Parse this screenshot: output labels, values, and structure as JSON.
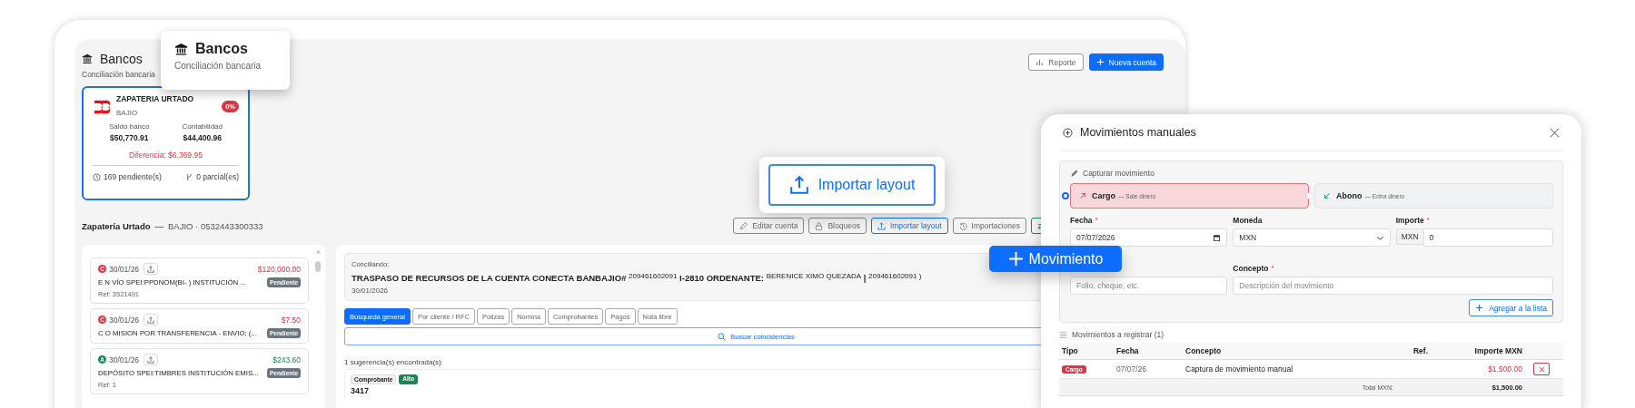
{
  "header": {
    "title": "Bancos",
    "subtitle": "Conciliación bancaria"
  },
  "header_actions": [
    {
      "label": "Reporte",
      "kind": "outline"
    },
    {
      "label": "Nueva cuenta",
      "kind": "primary"
    }
  ],
  "callout_bancos": {
    "title": "Bancos",
    "subtitle": "Conciliación bancaria"
  },
  "account_card": {
    "name": "ZAPATERIA URTADO",
    "bank": "BAJIO",
    "badge": "0%",
    "selected": true,
    "stats": [
      {
        "label": "Saldo banco",
        "value": "$50,770.91"
      },
      {
        "label": "Contabilidad",
        "value": "$44,400.96"
      }
    ],
    "difference": "Diferencia: $6,369.95",
    "pending": "169 pendiente(s)",
    "partial": "0 parcial(es)"
  },
  "account_bar": {
    "name": "Zapatería Urtado",
    "separator": "—",
    "detail": "BAJIO · 0532443300333"
  },
  "toolbar": [
    {
      "label": "Editar cuenta",
      "kind": "edit"
    },
    {
      "label": "Bloqueos",
      "kind": "lock"
    },
    {
      "label": "Importar layout",
      "kind": "import"
    },
    {
      "label": "Importaciones",
      "kind": "history"
    },
    {
      "kind": "transfer"
    }
  ],
  "movements": [
    {
      "type": "C",
      "kind": "cargo",
      "date": "30/01/26",
      "amount": "$120,000.00",
      "description": "E N VÍO SPEI:PPDNOM(BI- ) INSTITUCIÓN ...",
      "status": "Pendiente",
      "ref": "Ref: 3521491"
    },
    {
      "type": "C",
      "kind": "cargo",
      "date": "30/01/26",
      "amount": "$7.50",
      "description": "C O MISION POR TRANSFERENCIA - ENVIO; (...",
      "status": "Pendiente"
    },
    {
      "type": "A",
      "kind": "abono",
      "date": "30/01/26",
      "amount": "$243.60",
      "description": "DEPÓSITO SPEI:TIMBRES INSTITUCIÓN EMIS...",
      "status": "Pendiente",
      "ref": "Ref: 1"
    }
  ],
  "conciliando": {
    "label": "Conciliando:",
    "concept": "TRASPASO DE RECURSOS DE LA CUENTA CONECTA BANBAJIO# $^{209461602091}$ I-2810 ORDENANTE: $^{BERENICE XIMO QUEZADA}$ | $^{209461602091 )}$",
    "date": "30/01/2026"
  },
  "search_tabs": [
    {
      "label": "Búsqueda general",
      "selected": true
    },
    {
      "label": "Por cliente / RFC",
      "selected": false
    },
    {
      "label": "Pólizas",
      "selected": false
    },
    {
      "label": "Nómina",
      "selected": false
    },
    {
      "label": "Comprobantes",
      "selected": false
    },
    {
      "label": "Pagos",
      "selected": false
    },
    {
      "label": "Nota libre",
      "selected": false
    }
  ],
  "search_button": "Buscar coincidencias",
  "suggestions_label": "1 sugerencia(s) encontrada(s):",
  "suggestions": [
    {
      "type": "Comprobante",
      "confidence": "Alto",
      "title": "3417"
    }
  ],
  "callout_import": {
    "label": "Importar layout"
  },
  "callout_movimiento": {
    "label": "Movimiento"
  },
  "modal": {
    "title": "Movimientos manuales",
    "section": "Capturar movimiento",
    "types": [
      {
        "label": "Cargo",
        "hint": "— Sale dinero",
        "kind": "cargo",
        "selected": true
      },
      {
        "label": "Abono",
        "hint": "— Entra dinero",
        "kind": "abono",
        "selected": false
      }
    ],
    "fields": [
      {
        "kind": "date",
        "label": "Fecha",
        "required_mark": "*",
        "value": "07/07/2026"
      },
      {
        "kind": "select",
        "label": "Moneda",
        "value": "MXN"
      },
      {
        "kind": "amount",
        "label": "Importe",
        "required_mark": "*",
        "prefix": "MXN",
        "value": "0"
      },
      {
        "kind": "text",
        "placeholder": "Folio, cheque, etc."
      },
      {
        "kind": "wide",
        "label": "Concepto",
        "required_mark": "*",
        "placeholder": "Descripción del movimiento"
      }
    ],
    "add_button": "Agregar a la lista",
    "list_title": "Movimientos a registrar (1)",
    "columns": [
      "Tipo",
      "Fecha",
      "Concepto",
      "Ref.",
      "Importe MXN"
    ],
    "rows": [
      {
        "type": "Cargo",
        "kind": "cargo",
        "date": "07/07/26",
        "concept": "Captura de movimiento manual",
        "amount": "$1,500.00"
      }
    ],
    "total_label": "Total MXN:",
    "total": "$1,500.00"
  }
}
